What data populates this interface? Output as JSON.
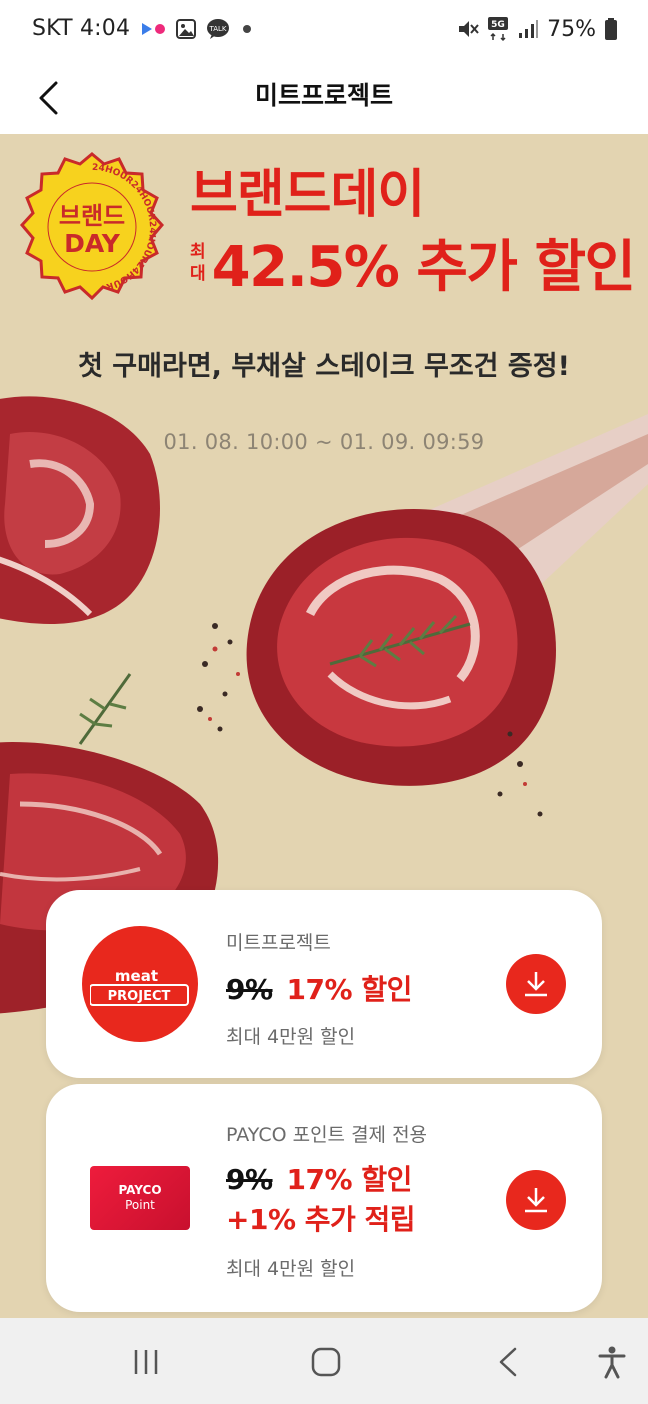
{
  "status_bar": {
    "carrier": "SKT",
    "time": "4:04",
    "battery": "75%",
    "network": "5G",
    "icons": [
      "flickr-icon",
      "gallery-icon",
      "talk-icon",
      "dot-icon",
      "mute-icon",
      "signal-icon",
      "battery-icon"
    ]
  },
  "app_bar": {
    "title": "미트프로젝트",
    "back_icon": "chevron-left-icon"
  },
  "banner": {
    "badge_line1": "브랜드",
    "badge_line2": "DAY",
    "badge_ring_text": "24HOUR24HOUR24HOUR24HOUR",
    "headline": "브랜드데이",
    "max_label_top": "최",
    "max_label_bottom": "대",
    "discount": "42.5% 추가 할인",
    "sub_headline": "첫 구매라면, 부채살 스테이크 무조건 증정!",
    "period": "01. 08. 10:00 ~ 01. 09. 09:59"
  },
  "coupons": [
    {
      "brand": "미트프로젝트",
      "logo_text_1": "meat",
      "logo_text_2": "PROJECT",
      "old_rate": "9%",
      "new_rate": "17% 할인",
      "note": "최대 4만원 할인"
    },
    {
      "brand": "PAYCO 포인트 결제 전용",
      "logo_text_1": "PAYCO",
      "logo_text_2": "Point",
      "old_rate": "9%",
      "new_rate": "17% 할인",
      "extra": "+1% 추가 적립",
      "note": "최대 4만원 할인"
    }
  ],
  "colors": {
    "accent": "#e0211a",
    "banner_bg": "#e3d4b1",
    "badge_yellow": "#f7d21e"
  }
}
